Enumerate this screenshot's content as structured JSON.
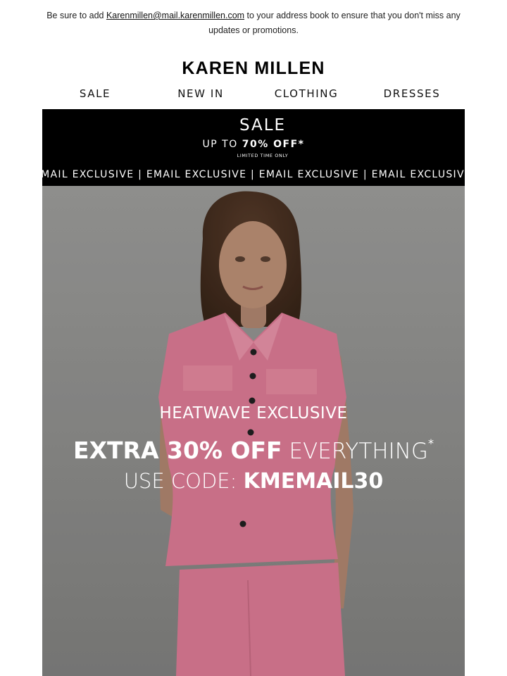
{
  "preheader": {
    "before": "Be sure to add ",
    "email": "Karenmillen@mail.karenmillen.com",
    "after": " to your address book to ensure that you don't miss any updates or promotions."
  },
  "brand": {
    "logo_text": "KAREN MILLEN"
  },
  "nav": {
    "items": [
      {
        "label": "SALE"
      },
      {
        "label": "NEW IN"
      },
      {
        "label": "CLOTHING"
      },
      {
        "label": "DRESSES"
      }
    ]
  },
  "sale_banner": {
    "title": "SALE",
    "subtitle_prefix": "UP TO ",
    "subtitle_bold": "70% OFF*",
    "small_print": "LIMITED TIME ONLY",
    "ticker_text": "EMAIL EXCLUSIVE | EMAIL EXCLUSIVE | EMAIL EXCLUSIVE | EMAIL EXCLUSIVE |"
  },
  "hero": {
    "kicker": "HEATWAVE EXCLUSIVE",
    "offer_bold": "EXTRA 30% OFF",
    "offer_thin": " EVERYTHING",
    "offer_mark": "*",
    "code_prefix": "USE CODE: ",
    "code_value": "KMEMAIL30",
    "garment_color": "#e47f9a",
    "background_color": "#8f8f8d"
  }
}
